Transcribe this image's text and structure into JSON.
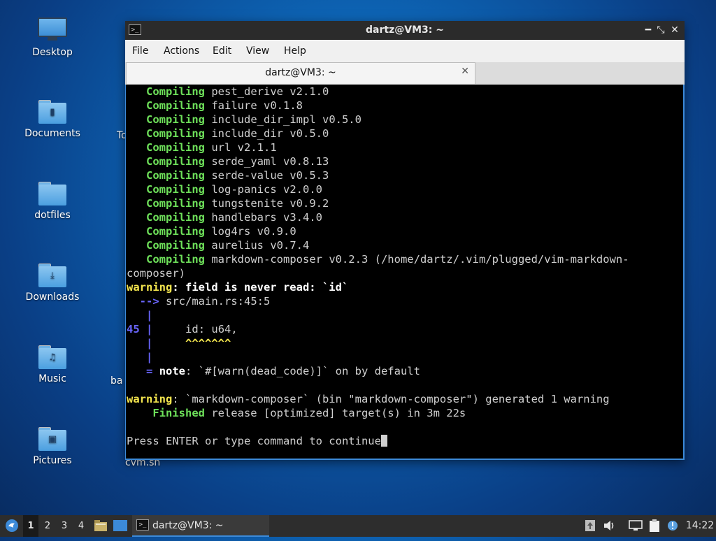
{
  "desktop": {
    "icons": [
      {
        "label": "Desktop"
      },
      {
        "label": "Documents"
      },
      {
        "label": "dotfiles"
      },
      {
        "label": "Downloads"
      },
      {
        "label": "Music"
      },
      {
        "label": "Pictures"
      }
    ],
    "partial_labels": [
      "To",
      "ba",
      "cvm.sh"
    ]
  },
  "window": {
    "title": "dartz@VM3: ~",
    "menu": [
      "File",
      "Actions",
      "Edit",
      "View",
      "Help"
    ],
    "tab_label": "dartz@VM3: ~",
    "terminal": {
      "compiling_word": "Compiling",
      "crates": [
        "pest_derive v2.1.0",
        "failure v0.1.8",
        "include_dir_impl v0.5.0",
        "include_dir v0.5.0",
        "url v2.1.1",
        "serde_yaml v0.8.13",
        "serde-value v0.5.3",
        "log-panics v2.0.0",
        "tungstenite v0.9.2",
        "handlebars v3.4.0",
        "log4rs v0.9.0",
        "aurelius v0.7.4",
        "markdown-composer v0.2.3 (/home/dartz/.vim/plugged/vim-markdown-"
      ],
      "wrap_line": "composer)",
      "warning_word": "warning",
      "warn1_msg": ": field is never read: `id`",
      "arrow": "-->",
      "location": " src/main.rs:45:5",
      "pipe": "|",
      "line_no": "45",
      "code": "    id: u64,",
      "carets": "^^^^^^^",
      "eq": "=",
      "note_word": "note",
      "note_msg": ": `#[warn(dead_code)]` on by default",
      "warn2_msg": ": `markdown-composer` (bin \"markdown-composer\") generated 1 warning",
      "finished_word": "Finished",
      "finished_msg": " release [optimized] target(s) in 3m 22s",
      "prompt": "Press ENTER or type command to continue"
    }
  },
  "taskbar": {
    "workspaces": [
      "1",
      "2",
      "3",
      "4"
    ],
    "task_label": "dartz@VM3: ~",
    "clock": "14:22"
  },
  "colors": {
    "compiling": "#6ee05a",
    "warning": "#f4e64e",
    "gutter": "#6a66ff",
    "window_border": "#3c8ad8"
  }
}
